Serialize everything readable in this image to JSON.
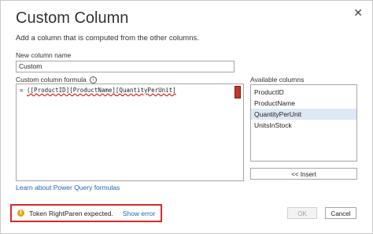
{
  "dialog": {
    "title": "Custom Column",
    "subtitle": "Add a column that is computed from the other columns.",
    "close_glyph": "✕"
  },
  "name_field": {
    "label": "New column name",
    "value": "Custom"
  },
  "formula": {
    "label": "Custom column formula",
    "info_glyph": "i",
    "prefix": "= ",
    "text_before": "([ProductID][ProductName]",
    "text_error": "[QuantityPerUnit]"
  },
  "available_columns": {
    "label": "Available columns",
    "items": [
      "ProductID",
      "ProductName",
      "QuantityPerUnit",
      "UnitsInStock"
    ],
    "selected_index": 2
  },
  "insert_label": "<< Insert",
  "learn_link": "Learn about Power Query formulas",
  "error": {
    "icon": "warning-icon",
    "glyph": "!",
    "message": "Token RightParen expected.",
    "link": "Show error",
    "highlight_color": "#d62a2a"
  },
  "buttons": {
    "ok": "OK",
    "cancel": "Cancel"
  }
}
